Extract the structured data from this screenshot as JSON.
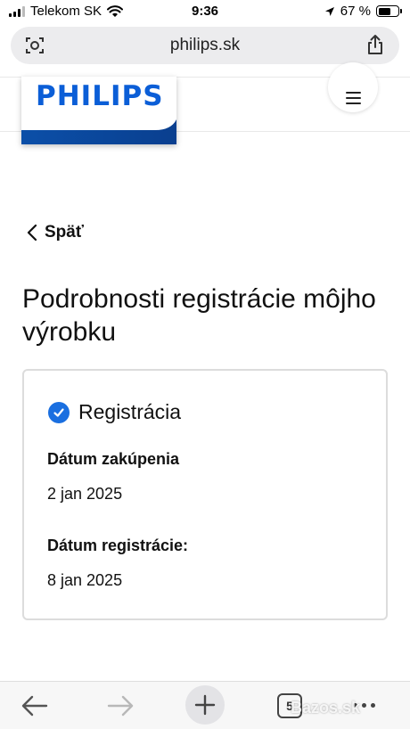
{
  "status_bar": {
    "carrier": "Telekom SK",
    "time": "9:36",
    "battery": "67 %"
  },
  "browser": {
    "url": "philips.sk",
    "tab_count": "5",
    "watermark": "Bazos.sk"
  },
  "header": {
    "logo": "PHILIPS",
    "brand_color": "#0b5ed7"
  },
  "page": {
    "back_label": "Späť",
    "title": "Podrobnosti registrácie môjho výrobku"
  },
  "card": {
    "title": "Registrácia",
    "purchase_label": "Dátum zakúpenia",
    "purchase_value": "2 jan 2025",
    "registration_label": "Dátum registrácie:",
    "registration_value": "8 jan 2025"
  }
}
